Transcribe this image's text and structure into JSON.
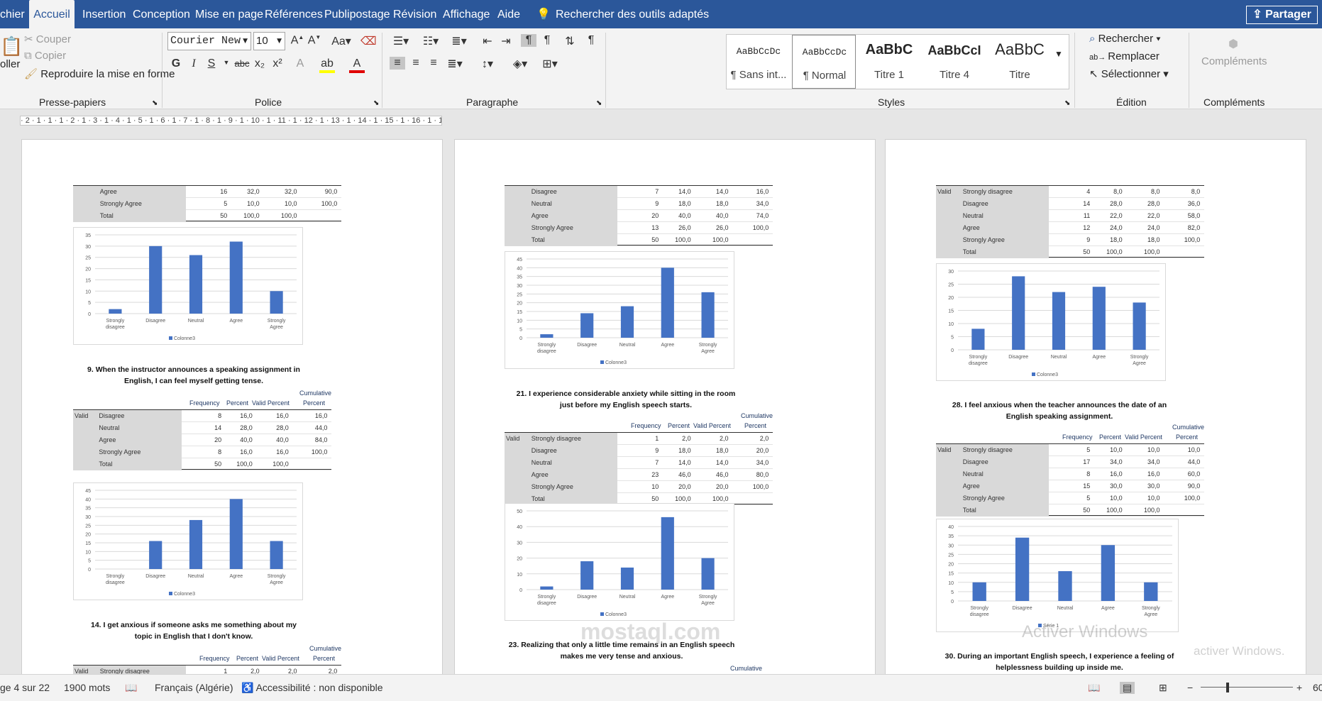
{
  "tabs": [
    "chier",
    "Accueil",
    "Insertion",
    "Conception",
    "Mise en page",
    "Références",
    "Publipostage",
    "Révision",
    "Affichage",
    "Aide",
    "Rechercher des outils adaptés"
  ],
  "share_label": "Partager",
  "ribbon": {
    "clipboard": {
      "paste": "oller",
      "cut": "Couper",
      "copy": "Copier",
      "format_painter": "Reproduire la mise en forme",
      "label": "Presse-papiers"
    },
    "font": {
      "name": "Courier New",
      "size": "10",
      "bold": "G",
      "italic": "I",
      "underline": "S",
      "strike": "abc",
      "sub": "x₂",
      "sup": "x²",
      "label": "Police"
    },
    "paragraph": {
      "label": "Paragraphe"
    },
    "styles": {
      "items": [
        {
          "preview": "AaBbCcDc",
          "name": "¶ Sans int..."
        },
        {
          "preview": "AaBbCcDc",
          "name": "¶ Normal"
        },
        {
          "preview": "AaBbC",
          "name": "Titre 1"
        },
        {
          "preview": "AaBbCcI",
          "name": "Titre 4"
        },
        {
          "preview": "AaBbC",
          "name": "Titre"
        }
      ],
      "label": "Styles"
    },
    "editing": {
      "find": "Rechercher",
      "replace": "Remplacer",
      "select": "Sélectionner",
      "label": "Édition"
    },
    "addins": {
      "button": "Compléments",
      "label": "Compléments"
    }
  },
  "ruler_text": "· 2 · 1 · 1 · 1 · 2 · 1 · 3 · 1 · 4 · 1 · 5 · 1 · 6 · 1 · 7 · 1 · 8 · 1 · 9 · 1 · 10 · 1 · 11 · 1 · 12 · 1 · 13 · 1 · 14 · 1 · 15 · 1 · 16 · 1 · 17 · 1 · 18 ·",
  "table_headers": {
    "frequency": "Frequency",
    "percent": "Percent",
    "valid_percent": "Valid Percent",
    "cumulative": "Cumulative",
    "cum_percent": "Percent",
    "valid": "Valid",
    "total": "Total"
  },
  "pages": [
    {
      "top_table": [
        [
          "Agree",
          "16",
          "32,0",
          "32,0",
          "90,0"
        ],
        [
          "Strongly Agree",
          "5",
          "10,0",
          "10,0",
          "100,0"
        ],
        [
          "Total",
          "50",
          "100,0",
          "100,0",
          ""
        ]
      ],
      "chart1": {
        "legend": "Colonne3"
      },
      "q1": "9. When the instructor announces a speaking assignment in English, I can feel myself getting tense.",
      "table1": [
        [
          "Disagree",
          "8",
          "16,0",
          "16,0",
          "16,0"
        ],
        [
          "Neutral",
          "14",
          "28,0",
          "28,0",
          "44,0"
        ],
        [
          "Agree",
          "20",
          "40,0",
          "40,0",
          "84,0"
        ],
        [
          "Strongly Agree",
          "8",
          "16,0",
          "16,0",
          "100,0"
        ],
        [
          "Total",
          "50",
          "100,0",
          "100,0",
          ""
        ]
      ],
      "chart2": {
        "legend": "Colonne3"
      },
      "q2": "14. I get anxious if someone asks me something about my topic in English that I don't know.",
      "table2": [
        [
          "Strongly disagree",
          "1",
          "2,0",
          "2,0",
          "2,0"
        ]
      ]
    },
    {
      "top_table": [
        [
          "Disagree",
          "7",
          "14,0",
          "14,0",
          "16,0"
        ],
        [
          "Neutral",
          "9",
          "18,0",
          "18,0",
          "34,0"
        ],
        [
          "Agree",
          "20",
          "40,0",
          "40,0",
          "74,0"
        ],
        [
          "Strongly Agree",
          "13",
          "26,0",
          "26,0",
          "100,0"
        ],
        [
          "Total",
          "50",
          "100,0",
          "100,0",
          ""
        ]
      ],
      "chart1": {
        "legend": "Colonne3"
      },
      "q1": "21. I experience considerable anxiety while sitting in the room just before my English speech starts.",
      "table1": [
        [
          "Strongly disagree",
          "1",
          "2,0",
          "2,0",
          "2,0"
        ],
        [
          "Disagree",
          "9",
          "18,0",
          "18,0",
          "20,0"
        ],
        [
          "Neutral",
          "7",
          "14,0",
          "14,0",
          "34,0"
        ],
        [
          "Agree",
          "23",
          "46,0",
          "46,0",
          "80,0"
        ],
        [
          "Strongly Agree",
          "10",
          "20,0",
          "20,0",
          "100,0"
        ],
        [
          "Total",
          "50",
          "100,0",
          "100,0",
          ""
        ]
      ],
      "chart2": {
        "legend": "Colonne3"
      },
      "q2": "23. Realizing that only a little time remains in an English speech makes me very tense and anxious.",
      "cum_bottom": "Cumulative"
    },
    {
      "top_table": [
        [
          "Strongly disagree",
          "4",
          "8,0",
          "8,0",
          "8,0"
        ],
        [
          "Disagree",
          "14",
          "28,0",
          "28,0",
          "36,0"
        ],
        [
          "Neutral",
          "11",
          "22,0",
          "22,0",
          "58,0"
        ],
        [
          "Agree",
          "12",
          "24,0",
          "24,0",
          "82,0"
        ],
        [
          "Strongly Agree",
          "9",
          "18,0",
          "18,0",
          "100,0"
        ],
        [
          "Total",
          "50",
          "100,0",
          "100,0",
          ""
        ]
      ],
      "chart1": {
        "legend": "Colonne3"
      },
      "q1": "28. I feel anxious when the teacher announces the date of an English speaking assignment.",
      "table1": [
        [
          "Strongly disagree",
          "5",
          "10,0",
          "10,0",
          "10,0"
        ],
        [
          "Disagree",
          "17",
          "34,0",
          "34,0",
          "44,0"
        ],
        [
          "Neutral",
          "8",
          "16,0",
          "16,0",
          "60,0"
        ],
        [
          "Agree",
          "15",
          "30,0",
          "30,0",
          "90,0"
        ],
        [
          "Strongly Agree",
          "5",
          "10,0",
          "10,0",
          "100,0"
        ],
        [
          "Total",
          "50",
          "100,0",
          "100,0",
          ""
        ]
      ],
      "chart2": {
        "legend": "Série 1"
      },
      "q2": "30. During an important English speech, I experience a feeling of helplessness building up inside me."
    }
  ],
  "chart_data": [
    {
      "type": "bar",
      "categories": [
        "Strongly disagree",
        "Disagree",
        "Neutral",
        "Agree",
        "Strongly Agree"
      ],
      "series": [
        {
          "name": "Colonne3",
          "values": [
            2,
            30,
            26,
            32,
            10
          ]
        }
      ],
      "ylim": [
        0,
        35
      ],
      "yticks": [
        0,
        5,
        10,
        15,
        20,
        25,
        30,
        35
      ]
    },
    {
      "type": "bar",
      "categories": [
        "Strongly disagree",
        "Disagree",
        "Neutral",
        "Agree",
        "Strongly Agree"
      ],
      "series": [
        {
          "name": "Colonne3",
          "values": [
            0,
            16,
            28,
            40,
            16
          ]
        }
      ],
      "ylim": [
        0,
        45
      ],
      "yticks": [
        0,
        5,
        10,
        15,
        20,
        25,
        30,
        35,
        40,
        45
      ]
    },
    {
      "type": "bar",
      "categories": [
        "Strongly disagree",
        "Disagree",
        "Neutral",
        "Agree",
        "Strongly Agree"
      ],
      "series": [
        {
          "name": "Colonne3",
          "values": [
            2,
            14,
            18,
            40,
            26
          ]
        }
      ],
      "ylim": [
        0,
        45
      ],
      "yticks": [
        0,
        5,
        10,
        15,
        20,
        25,
        30,
        35,
        40,
        45
      ]
    },
    {
      "type": "bar",
      "categories": [
        "Strongly disagree",
        "Disagree",
        "Neutral",
        "Agree",
        "Strongly Agree"
      ],
      "series": [
        {
          "name": "Colonne3",
          "values": [
            2,
            18,
            14,
            46,
            20
          ]
        }
      ],
      "ylim": [
        0,
        50
      ],
      "yticks": [
        0,
        10,
        20,
        30,
        40,
        50
      ]
    },
    {
      "type": "bar",
      "categories": [
        "Strongly disagree",
        "Disagree",
        "Neutral",
        "Agree",
        "Strongly Agree"
      ],
      "series": [
        {
          "name": "Colonne3",
          "values": [
            8,
            28,
            22,
            24,
            18
          ]
        }
      ],
      "ylim": [
        0,
        30
      ],
      "yticks": [
        0,
        5,
        10,
        15,
        20,
        25,
        30
      ]
    },
    {
      "type": "bar",
      "categories": [
        "Strongly disagree",
        "Disagree",
        "Neutral",
        "Agree",
        "Strongly Agree"
      ],
      "series": [
        {
          "name": "Série 1",
          "values": [
            10,
            34,
            16,
            30,
            10
          ]
        }
      ],
      "ylim": [
        0,
        40
      ],
      "yticks": [
        0,
        5,
        10,
        15,
        20,
        25,
        30,
        35,
        40
      ]
    }
  ],
  "status": {
    "page": "ge 4 sur 22",
    "words": "1900 mots",
    "language": "Français (Algérie)",
    "accessibility": "Accessibilité : non disponible",
    "zoom": "60"
  },
  "watermark": {
    "activate": "Activer Windows",
    "activate2": "activer Windows.",
    "site": "mostaql.com"
  },
  "colors": {
    "ribbon_blue": "#2b579a",
    "bar": "#4472c4"
  }
}
